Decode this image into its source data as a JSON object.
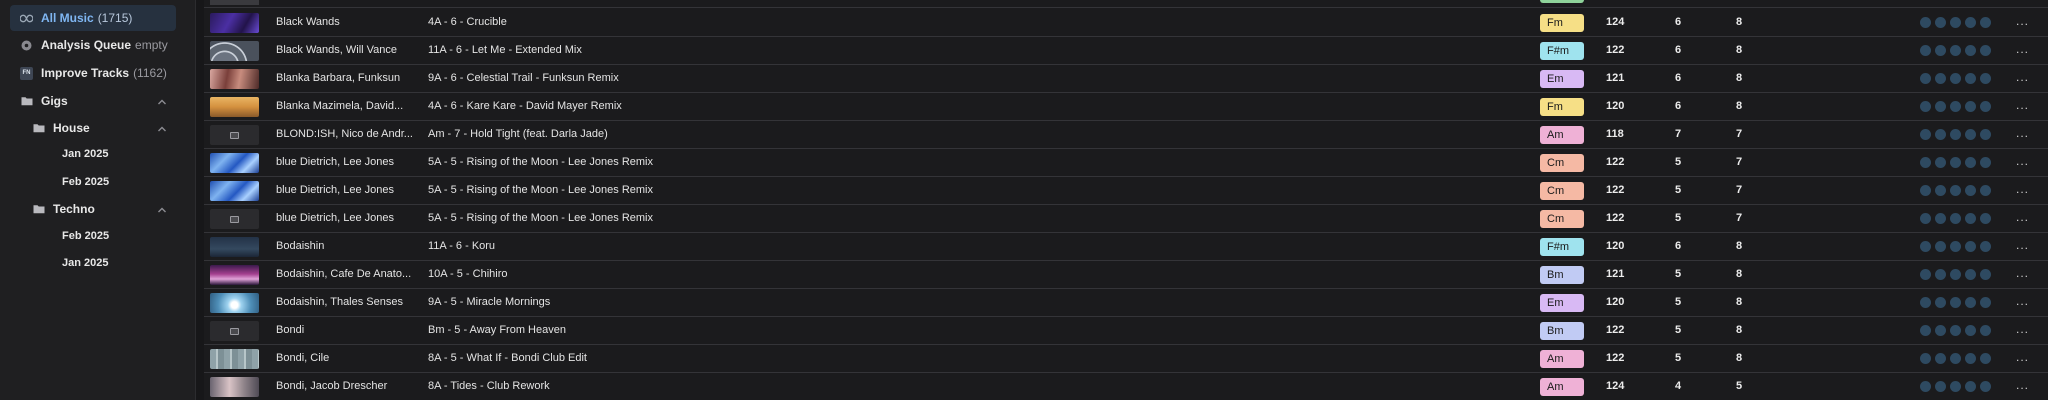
{
  "sidebar": {
    "all_music": {
      "label": "All Music",
      "count": "(1715)"
    },
    "analysis_queue": {
      "label": "Analysis Queue",
      "status": "empty"
    },
    "improve_tracks": {
      "label": "Improve Tracks",
      "count": "(1162)",
      "icon_text": "FN"
    },
    "gigs": {
      "label": "Gigs",
      "folders": [
        {
          "label": "House",
          "items": [
            "Jan 2025",
            "Feb 2025"
          ]
        },
        {
          "label": "Techno",
          "items": [
            "Feb 2025",
            "Jan 2025"
          ]
        }
      ]
    }
  },
  "colors": {
    "key_fm": "#f6df86",
    "key_fsm": "#9fe3ee",
    "key_em": "#d8b9f4",
    "key_am": "#efb1d6",
    "key_cm": "#f5b9a4",
    "key_bm": "#c1cbf4",
    "rating_dot": "#2e4a61",
    "active_nav": "#7fb6f2"
  },
  "tracks": [
    {
      "artist": "Black Wands",
      "title": "4A - 6 - Crucible",
      "key": "Fm",
      "bpm": "124",
      "energy": "6",
      "col3": "8",
      "thumb": "thumb-purple-stripes"
    },
    {
      "artist": "Black Wands, Will Vance",
      "title": "11A - 6 - Let Me - Extended Mix",
      "key": "F#m",
      "bpm": "122",
      "energy": "6",
      "col3": "8",
      "thumb": "thumb-grey-arcs"
    },
    {
      "artist": "Blanka Barbara, Funksun",
      "title": "9A - 6 - Celestial Trail - Funksun Remix",
      "key": "Em",
      "bpm": "121",
      "energy": "6",
      "col3": "8",
      "thumb": "thumb-pink-brown"
    },
    {
      "artist": "Blanka Mazimela, David...",
      "title": "4A - 6 - Kare Kare - David Mayer Remix",
      "key": "Fm",
      "bpm": "120",
      "energy": "6",
      "col3": "8",
      "thumb": "thumb-golden-hills"
    },
    {
      "artist": "BLOND:ISH, Nico de Andr...",
      "title": "Am - 7 - Hold Tight (feat. Darla Jade)",
      "key": "Am",
      "bpm": "118",
      "energy": "7",
      "col3": "7",
      "thumb": "placeholder"
    },
    {
      "artist": "blue Dietrich, Lee Jones",
      "title": "5A - 5 - Rising of the Moon - Lee Jones Remix",
      "key": "Cm",
      "bpm": "122",
      "energy": "5",
      "col3": "7",
      "thumb": "thumb-blue-swirl"
    },
    {
      "artist": "blue Dietrich, Lee Jones",
      "title": "5A - 5 - Rising of the Moon - Lee Jones Remix",
      "key": "Cm",
      "bpm": "122",
      "energy": "5",
      "col3": "7",
      "thumb": "thumb-blue-swirl"
    },
    {
      "artist": "blue Dietrich, Lee Jones",
      "title": "5A - 5 - Rising of the Moon - Lee Jones Remix",
      "key": "Cm",
      "bpm": "122",
      "energy": "5",
      "col3": "7",
      "thumb": "placeholder"
    },
    {
      "artist": "Bodaishin",
      "title": "11A - 6 - Koru",
      "key": "F#m",
      "bpm": "120",
      "energy": "6",
      "col3": "8",
      "thumb": "thumb-dark-teal"
    },
    {
      "artist": "Bodaishin, Cafe De Anato...",
      "title": "10A - 5 - Chihiro",
      "key": "Bm",
      "bpm": "121",
      "energy": "5",
      "col3": "8",
      "thumb": "thumb-magenta-sky"
    },
    {
      "artist": "Bodaishin, Thales Senses",
      "title": "9A - 5 - Miracle Mornings",
      "key": "Em",
      "bpm": "120",
      "energy": "5",
      "col3": "8",
      "thumb": "thumb-light-blue"
    },
    {
      "artist": "Bondi",
      "title": "Bm - 5 - Away From Heaven",
      "key": "Bm",
      "bpm": "122",
      "energy": "5",
      "col3": "8",
      "thumb": "placeholder"
    },
    {
      "artist": "Bondi, Cile",
      "title": "8A - 5 - What If - Bondi Club Edit",
      "key": "Am",
      "bpm": "122",
      "energy": "5",
      "col3": "8",
      "thumb": "thumb-grey-lines"
    },
    {
      "artist": "Bondi, Jacob Drescher",
      "title": "8A - Tides - Club Rework",
      "key": "Am",
      "bpm": "124",
      "energy": "4",
      "col3": "5",
      "thumb": "thumb-pink-haze"
    }
  ],
  "rating_max": 5,
  "more_label": "..."
}
